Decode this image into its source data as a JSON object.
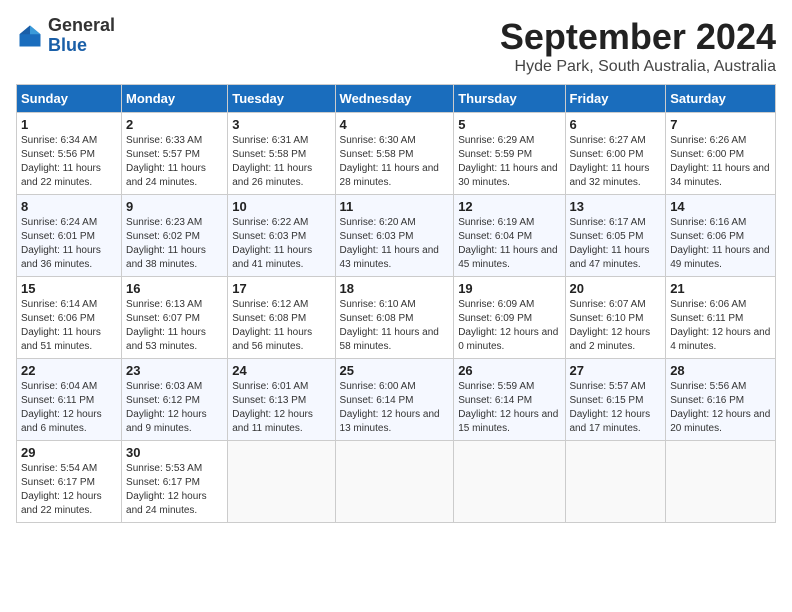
{
  "header": {
    "logo_general": "General",
    "logo_blue": "Blue",
    "month_title": "September 2024",
    "subtitle": "Hyde Park, South Australia, Australia"
  },
  "days_of_week": [
    "Sunday",
    "Monday",
    "Tuesday",
    "Wednesday",
    "Thursday",
    "Friday",
    "Saturday"
  ],
  "weeks": [
    [
      {
        "day": 1,
        "sunrise": "6:34 AM",
        "sunset": "5:56 PM",
        "daylight": "11 hours and 22 minutes."
      },
      {
        "day": 2,
        "sunrise": "6:33 AM",
        "sunset": "5:57 PM",
        "daylight": "11 hours and 24 minutes."
      },
      {
        "day": 3,
        "sunrise": "6:31 AM",
        "sunset": "5:58 PM",
        "daylight": "11 hours and 26 minutes."
      },
      {
        "day": 4,
        "sunrise": "6:30 AM",
        "sunset": "5:58 PM",
        "daylight": "11 hours and 28 minutes."
      },
      {
        "day": 5,
        "sunrise": "6:29 AM",
        "sunset": "5:59 PM",
        "daylight": "11 hours and 30 minutes."
      },
      {
        "day": 6,
        "sunrise": "6:27 AM",
        "sunset": "6:00 PM",
        "daylight": "11 hours and 32 minutes."
      },
      {
        "day": 7,
        "sunrise": "6:26 AM",
        "sunset": "6:00 PM",
        "daylight": "11 hours and 34 minutes."
      }
    ],
    [
      {
        "day": 8,
        "sunrise": "6:24 AM",
        "sunset": "6:01 PM",
        "daylight": "11 hours and 36 minutes."
      },
      {
        "day": 9,
        "sunrise": "6:23 AM",
        "sunset": "6:02 PM",
        "daylight": "11 hours and 38 minutes."
      },
      {
        "day": 10,
        "sunrise": "6:22 AM",
        "sunset": "6:03 PM",
        "daylight": "11 hours and 41 minutes."
      },
      {
        "day": 11,
        "sunrise": "6:20 AM",
        "sunset": "6:03 PM",
        "daylight": "11 hours and 43 minutes."
      },
      {
        "day": 12,
        "sunrise": "6:19 AM",
        "sunset": "6:04 PM",
        "daylight": "11 hours and 45 minutes."
      },
      {
        "day": 13,
        "sunrise": "6:17 AM",
        "sunset": "6:05 PM",
        "daylight": "11 hours and 47 minutes."
      },
      {
        "day": 14,
        "sunrise": "6:16 AM",
        "sunset": "6:06 PM",
        "daylight": "11 hours and 49 minutes."
      }
    ],
    [
      {
        "day": 15,
        "sunrise": "6:14 AM",
        "sunset": "6:06 PM",
        "daylight": "11 hours and 51 minutes."
      },
      {
        "day": 16,
        "sunrise": "6:13 AM",
        "sunset": "6:07 PM",
        "daylight": "11 hours and 53 minutes."
      },
      {
        "day": 17,
        "sunrise": "6:12 AM",
        "sunset": "6:08 PM",
        "daylight": "11 hours and 56 minutes."
      },
      {
        "day": 18,
        "sunrise": "6:10 AM",
        "sunset": "6:08 PM",
        "daylight": "11 hours and 58 minutes."
      },
      {
        "day": 19,
        "sunrise": "6:09 AM",
        "sunset": "6:09 PM",
        "daylight": "12 hours and 0 minutes."
      },
      {
        "day": 20,
        "sunrise": "6:07 AM",
        "sunset": "6:10 PM",
        "daylight": "12 hours and 2 minutes."
      },
      {
        "day": 21,
        "sunrise": "6:06 AM",
        "sunset": "6:11 PM",
        "daylight": "12 hours and 4 minutes."
      }
    ],
    [
      {
        "day": 22,
        "sunrise": "6:04 AM",
        "sunset": "6:11 PM",
        "daylight": "12 hours and 6 minutes."
      },
      {
        "day": 23,
        "sunrise": "6:03 AM",
        "sunset": "6:12 PM",
        "daylight": "12 hours and 9 minutes."
      },
      {
        "day": 24,
        "sunrise": "6:01 AM",
        "sunset": "6:13 PM",
        "daylight": "12 hours and 11 minutes."
      },
      {
        "day": 25,
        "sunrise": "6:00 AM",
        "sunset": "6:14 PM",
        "daylight": "12 hours and 13 minutes."
      },
      {
        "day": 26,
        "sunrise": "5:59 AM",
        "sunset": "6:14 PM",
        "daylight": "12 hours and 15 minutes."
      },
      {
        "day": 27,
        "sunrise": "5:57 AM",
        "sunset": "6:15 PM",
        "daylight": "12 hours and 17 minutes."
      },
      {
        "day": 28,
        "sunrise": "5:56 AM",
        "sunset": "6:16 PM",
        "daylight": "12 hours and 20 minutes."
      }
    ],
    [
      {
        "day": 29,
        "sunrise": "5:54 AM",
        "sunset": "6:17 PM",
        "daylight": "12 hours and 22 minutes."
      },
      {
        "day": 30,
        "sunrise": "5:53 AM",
        "sunset": "6:17 PM",
        "daylight": "12 hours and 24 minutes."
      },
      null,
      null,
      null,
      null,
      null
    ]
  ]
}
